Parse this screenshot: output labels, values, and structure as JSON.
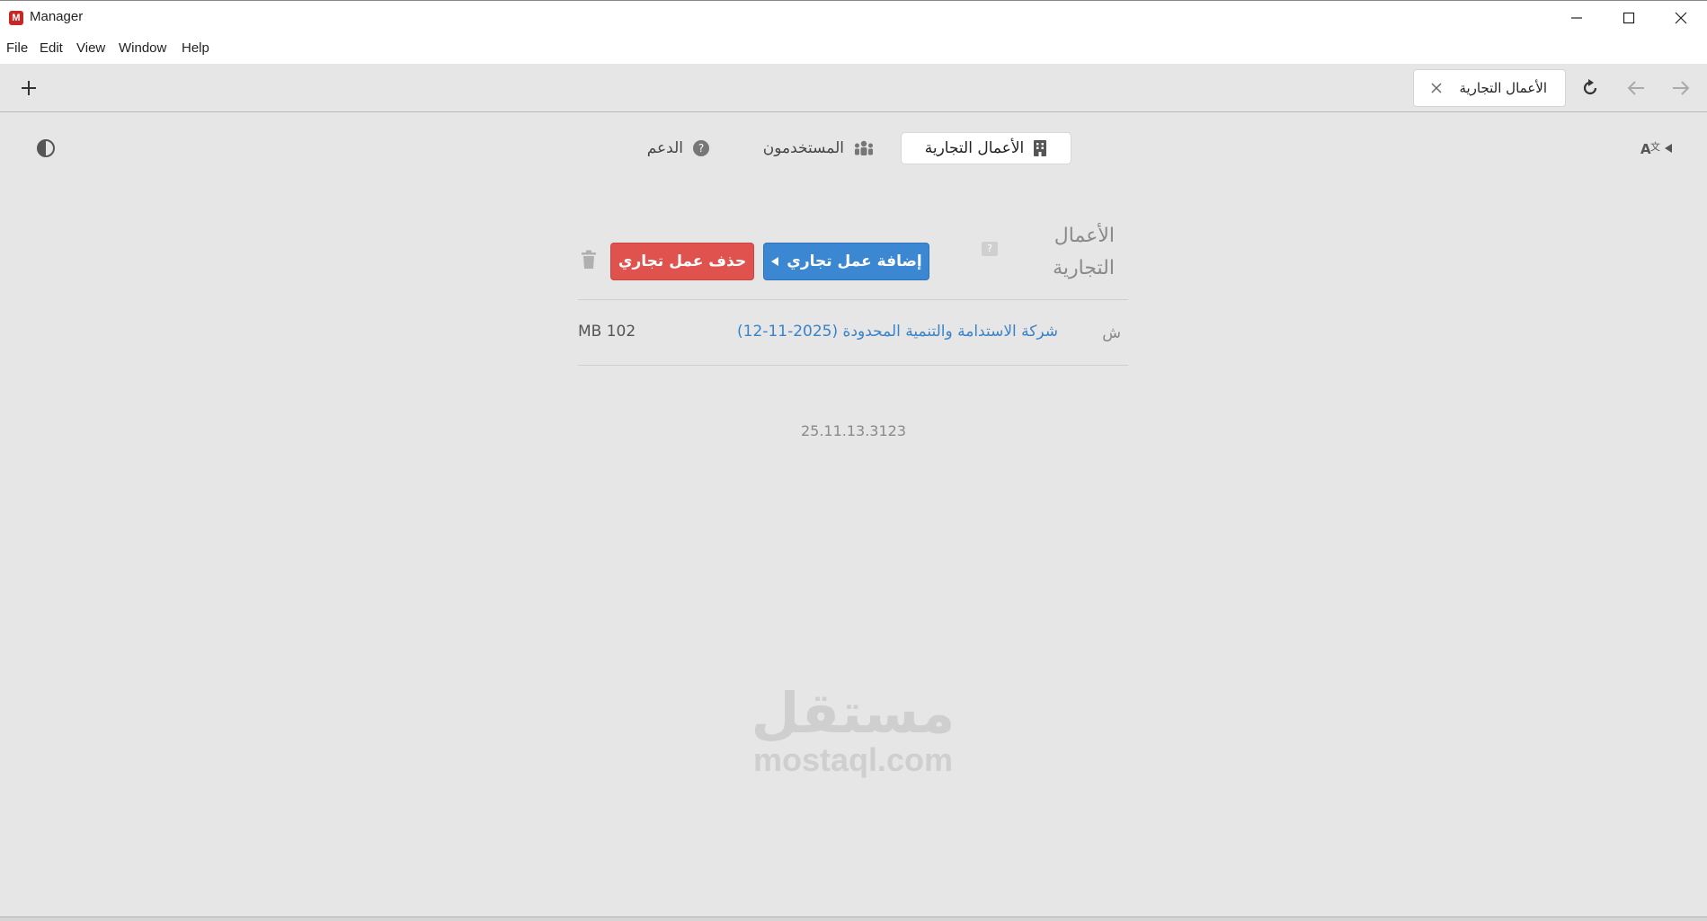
{
  "window": {
    "logo_letter": "M",
    "title": "Manager"
  },
  "menu": {
    "file": "File",
    "edit": "Edit",
    "view": "View",
    "window": "Window",
    "help": "Help"
  },
  "toolbar": {
    "open_tab_label": "الأعمال التجارية"
  },
  "nav": {
    "businesses": "الأعمال التجارية",
    "users": "المستخدمون",
    "support": "الدعم"
  },
  "section": {
    "title": "الأعمال التجارية",
    "help_badge": "?",
    "add_button": "إضافة عمل تجاري",
    "delete_button": "حذف عمل تجاري"
  },
  "businesses": [
    {
      "type_marker": "ش",
      "name": "شركة الاستدامة والتنمية المحدودة (2025-11-12)",
      "size": "MB 102"
    }
  ],
  "footer": {
    "version": "25.11.13.3123"
  },
  "watermark": {
    "arabic": "مستقل",
    "latin": "mostaql.com"
  },
  "colors": {
    "add_button": "#3b87d2",
    "delete_button": "#e0524d",
    "link": "#3a83c9",
    "background": "#e6e6e6"
  }
}
